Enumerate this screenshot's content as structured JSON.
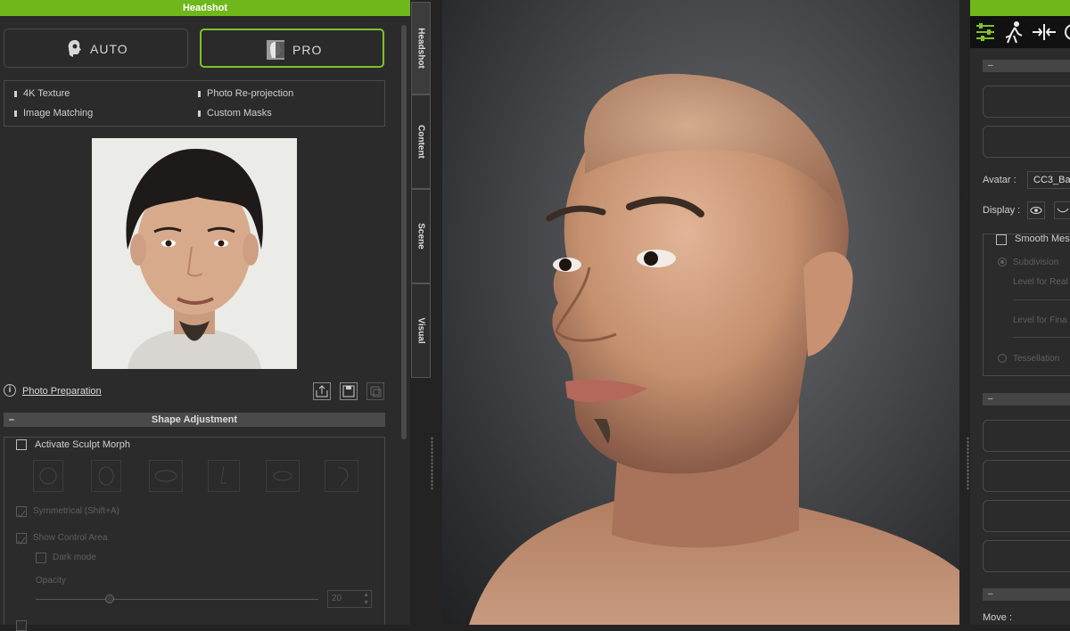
{
  "left_panel": {
    "title": "Headshot",
    "mode_buttons": {
      "auto": "AUTO",
      "pro": "PRO"
    },
    "features": [
      "4K Texture",
      "Photo Re-projection",
      "Image Matching",
      "Custom Masks"
    ],
    "photo_preparation": "Photo Preparation",
    "shape_adjustment": {
      "header": "Shape Adjustment",
      "activate_sculpt_morph": "Activate Sculpt Morph",
      "symmetrical": "Symmetrical (Shift+A)",
      "show_control_area": "Show Control Area",
      "dark_mode": "Dark mode",
      "opacity_label": "Opacity",
      "opacity_value": "20",
      "opacity_fraction": 0.2
    }
  },
  "side_tabs": [
    "Headshot",
    "Content",
    "Scene",
    "Visual"
  ],
  "right_panel": {
    "section_collapse": "–",
    "avatar_label": "Avatar :",
    "avatar_value": "CC3_Ba",
    "display_label": "Display :",
    "smooth_mesh": "Smooth Mesh",
    "subdivision": "Subdivision",
    "level_realtime": "Level for Real",
    "level_final": "Level for Fina",
    "tessellation": "Tessellation",
    "move_label": "Move :"
  },
  "colors": {
    "accent_green": "#6eb81c",
    "panel_bg": "#2b2b2b"
  }
}
